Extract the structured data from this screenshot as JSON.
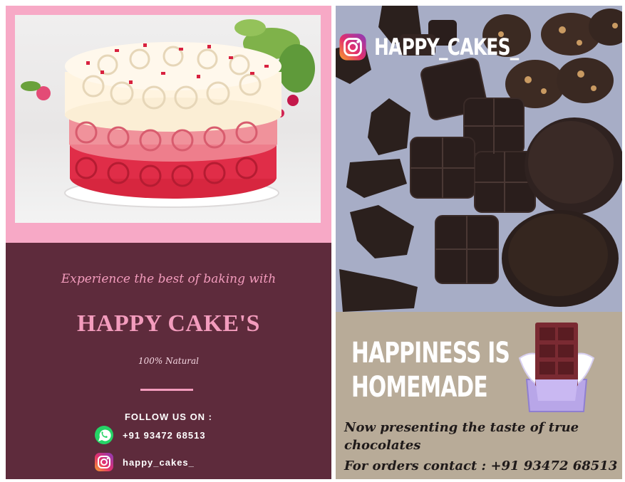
{
  "left_poster": {
    "tagline": "Experience the best of baking with",
    "brand": "HAPPY CAKE'S",
    "natural": "100% Natural",
    "follow_label": "FOLLOW US ON :",
    "whatsapp": "+91 93472 68513",
    "instagram": "happy_cakes_",
    "icons": [
      "whatsapp-icon",
      "instagram-icon"
    ],
    "colors": {
      "background": "#5e2b3c",
      "accent_pink": "#f39cbd"
    }
  },
  "right_poster": {
    "handle": "HAPPY_CAKES_",
    "headline_line1": "HAPPINESS IS",
    "headline_line2": "HOMEMADE",
    "presenting": "Now presenting the taste of true chocolates",
    "orders": "For orders contact : +91 93472 68513",
    "icons": [
      "instagram-icon",
      "chocolate-bar-icon"
    ],
    "colors": {
      "background": "#b8ab98"
    }
  }
}
